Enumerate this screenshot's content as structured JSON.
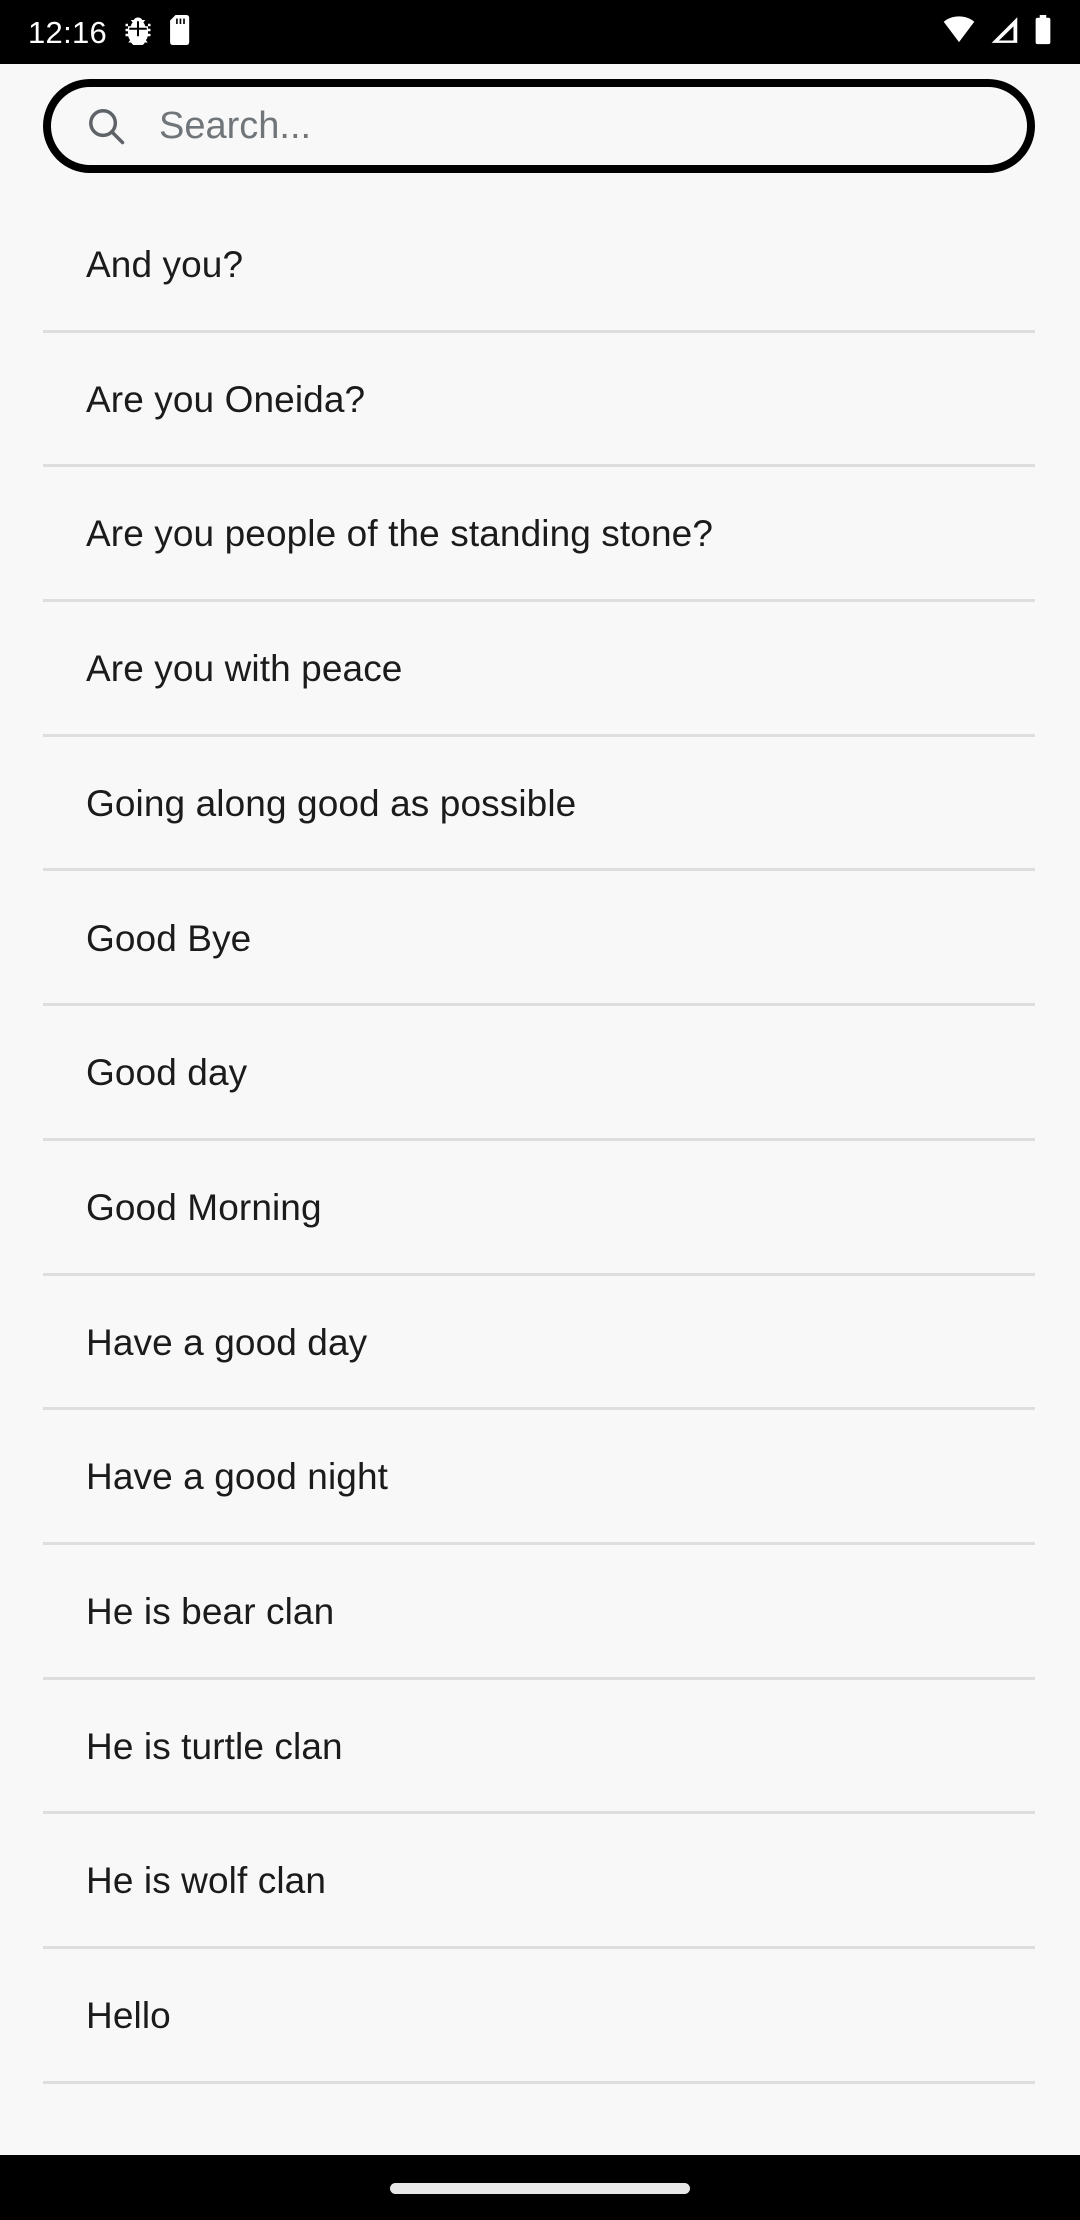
{
  "status_bar": {
    "time": "12:16",
    "background_color": "#000000",
    "foreground_color": "#ffffff",
    "left_icons": [
      {
        "name": "android-debug-bug-icon",
        "glyph": "bug"
      },
      {
        "name": "sd-card-icon",
        "glyph": "sd-card"
      }
    ],
    "right_icons": [
      {
        "name": "wifi-icon",
        "glyph": "wifi"
      },
      {
        "name": "cellular-signal-icon",
        "glyph": "signal"
      },
      {
        "name": "battery-icon",
        "glyph": "battery"
      }
    ]
  },
  "search": {
    "icon": "search-icon",
    "placeholder": "Search...",
    "value": "",
    "border_color": "#000000",
    "text_color": "#70757a"
  },
  "list": {
    "background_color": "#f8f8f8",
    "divider_color": "#dddedf",
    "text_color": "#1b1b1b",
    "items": [
      {
        "label": "And you?"
      },
      {
        "label": "Are you Oneida?"
      },
      {
        "label": "Are you people of the standing stone?"
      },
      {
        "label": "Are you with peace"
      },
      {
        "label": "Going along good as possible"
      },
      {
        "label": "Good Bye"
      },
      {
        "label": "Good day"
      },
      {
        "label": "Good Morning"
      },
      {
        "label": "Have a good day"
      },
      {
        "label": "Have a good night"
      },
      {
        "label": "He is bear clan"
      },
      {
        "label": "He is turtle clan"
      },
      {
        "label": "He is wolf clan"
      },
      {
        "label": "Hello"
      }
    ]
  },
  "navigation_bar": {
    "background_color": "#000000",
    "pill_color": "#e8e8e8",
    "gesture_handle": "home-gesture-pill"
  }
}
